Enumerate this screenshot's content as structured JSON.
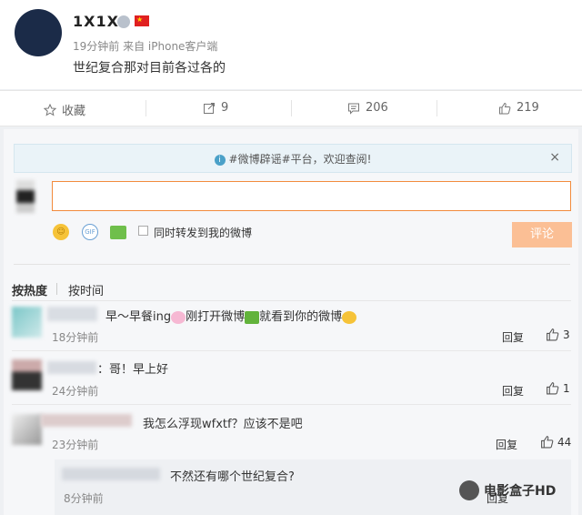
{
  "post": {
    "username": "1X1X",
    "time": "19分钟前",
    "source": "来自 iPhone客户端",
    "text": "世纪复合那对目前各过各的"
  },
  "actions": {
    "favorite_label": "收藏",
    "repost_count": "9",
    "comment_count": "206",
    "like_count": "219"
  },
  "notice": {
    "text": "#微博辟谣#平台，欢迎查阅!",
    "close": "×"
  },
  "composer": {
    "repost_label": "同时转发到我的微博",
    "submit_label": "评论",
    "gif_label": "GIF"
  },
  "sort": {
    "hot": "按热度",
    "time": "按时间"
  },
  "comments": [
    {
      "text_a": "早～早餐ing",
      "text_b": "刚打开微博",
      "text_c": "就看到你的微博",
      "time": "18分钟前",
      "reply": "回复",
      "likes": "3"
    },
    {
      "text": "：哥！早上好",
      "time": "24分钟前",
      "reply": "回复",
      "likes": "1"
    },
    {
      "text": "我怎么浮现wfxtf？应该不是吧",
      "time": "23分钟前",
      "reply": "回复",
      "likes": "44"
    }
  ],
  "sub_reply": {
    "text": "不然还有哪个世纪复合?",
    "time": "8分钟前",
    "reply": "回复"
  },
  "watermark": {
    "text": "电影盒子HD"
  },
  "colors": {
    "accent": "#f28b3c",
    "submit_bg": "#fbbf95",
    "notice_bg": "#eaf3f8"
  }
}
